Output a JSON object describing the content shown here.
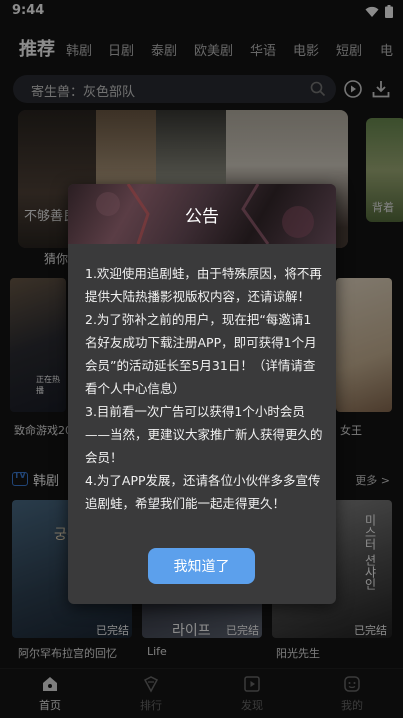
{
  "status_bar": {
    "time": "9:44"
  },
  "tabs": [
    "推荐",
    "韩剧",
    "日剧",
    "泰剧",
    "欧美剧",
    "华语",
    "电影",
    "短剧",
    "电"
  ],
  "search": {
    "placeholder": "寄生兽：灰色部队"
  },
  "banner": {
    "caption": "不够善良",
    "title": "猜你",
    "side_caption": "背着"
  },
  "posters_row1": {
    "left_title": "致命游戏20",
    "left_caption": "正在热播",
    "right_title": "女王"
  },
  "section": {
    "name": "韩剧",
    "more": "更多 >"
  },
  "posters_row2": [
    {
      "title": "阿尔罕布拉宫的回忆",
      "badge": "已完结",
      "art_text": "궁전"
    },
    {
      "title": "Life",
      "badge": "已完结",
      "art_text": "라이프"
    },
    {
      "title": "阳光先生",
      "badge": "已完结",
      "art_text": "미스터 션샤인"
    }
  ],
  "dialog": {
    "title": "公告",
    "paragraphs": [
      "1.欢迎使用追剧蛙，由于特殊原因，将不再提供大陆热播影视版权内容，还请谅解！",
      "2.为了弥补之前的用户，现在把“每邀请1名好友成功下载注册APP，即可获得1个月会员”的活动延长至5月31日！（详情请查看个人中心信息）",
      "3.目前看一次广告可以获得1个小时会员——当然，更建议大家推广新人获得更久的会员！",
      "4.为了APP发展，还请各位小伙伴多多宣传追剧蛙，希望我们能一起走得更久！"
    ],
    "button": "我知道了"
  },
  "bottom_nav": [
    {
      "label": "首页",
      "icon": "home-icon",
      "active": true
    },
    {
      "label": "排行",
      "icon": "rank-icon",
      "active": false
    },
    {
      "label": "发现",
      "icon": "discover-icon",
      "active": false
    },
    {
      "label": "我的",
      "icon": "profile-icon",
      "active": false
    }
  ]
}
